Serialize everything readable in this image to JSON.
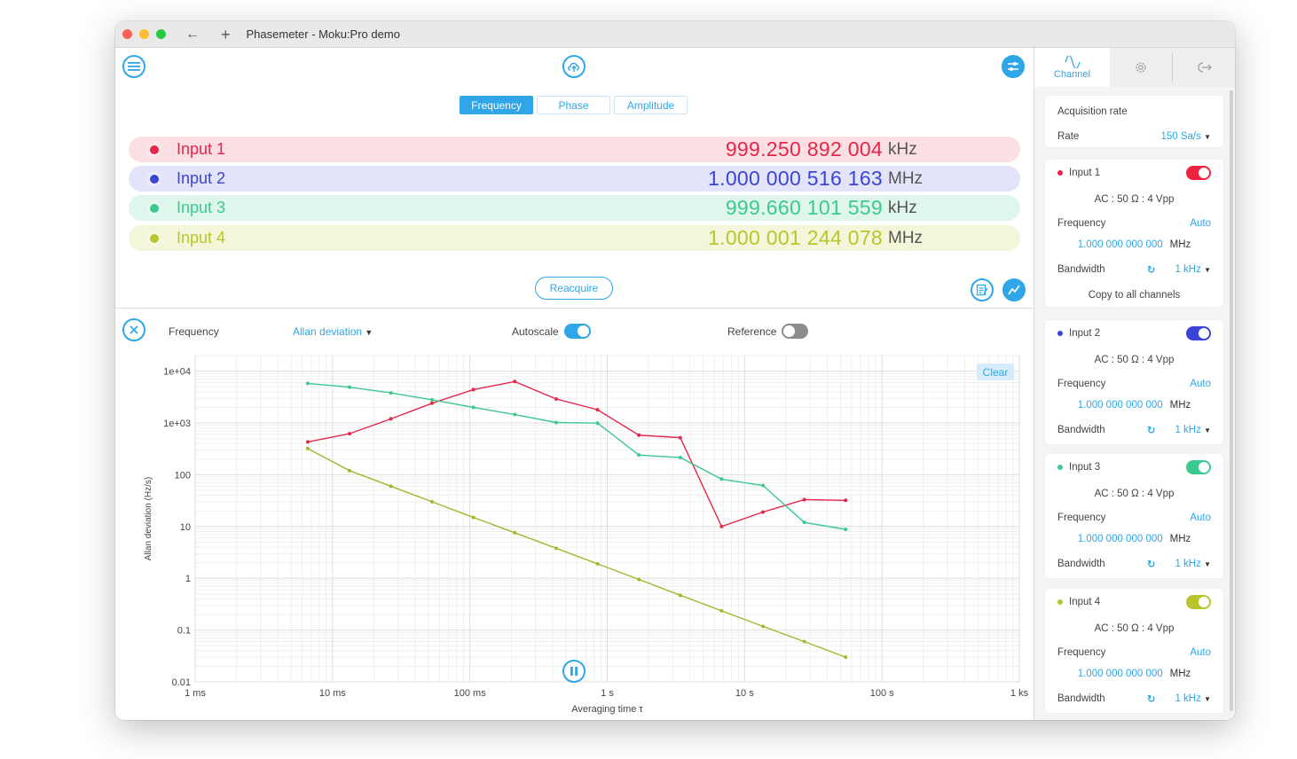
{
  "window": {
    "title": "Phasemeter - Moku:Pro demo"
  },
  "tabs": [
    {
      "label": "Frequency",
      "active": true
    },
    {
      "label": "Phase",
      "active": false
    },
    {
      "label": "Amplitude",
      "active": false
    }
  ],
  "readouts": [
    {
      "label": "Input 1",
      "value": "999.250 892 004",
      "unit": "kHz",
      "color": "#e5264a",
      "bg": "#fbdfe3"
    },
    {
      "label": "Input 2",
      "value": "1.000 000 516 163",
      "unit": "MHz",
      "color": "#3a44d6",
      "bg": "#e3e4fa"
    },
    {
      "label": "Input 3",
      "value": "999.660 101 559",
      "unit": "kHz",
      "color": "#3cc98f",
      "bg": "#dff6ec"
    },
    {
      "label": "Input 4",
      "value": "1.000 001 244 078",
      "unit": "MHz",
      "color": "#b9c52c",
      "bg": "#f4f6da"
    }
  ],
  "reacquire_label": "Reacquire",
  "plot_controls": {
    "measure": "Frequency",
    "statistic": "Allan deviation",
    "autoscale_label": "Autoscale",
    "autoscale_on": true,
    "reference_label": "Reference",
    "reference_on": false,
    "clear_label": "Clear"
  },
  "chart_data": {
    "type": "line",
    "xscale": "log",
    "yscale": "log",
    "xlabel": "Averaging time τ",
    "ylabel": "Allan deviation (Hz/s)",
    "xlim": [
      0.001,
      1000
    ],
    "ylim": [
      0.01,
      20000
    ],
    "x_ticks": [
      "1 ms",
      "10 ms",
      "100 ms",
      "1 s",
      "10 s",
      "100 s",
      "1 ks"
    ],
    "y_ticks": [
      "1e+04",
      "1e+03",
      "100",
      "10",
      "1",
      "0.1",
      "0.01"
    ],
    "grid": true,
    "x": [
      0.0066,
      0.0133,
      0.0266,
      0.053,
      0.106,
      0.212,
      0.425,
      0.85,
      1.7,
      3.4,
      6.8,
      13.6,
      27.2,
      54.4
    ],
    "series": [
      {
        "name": "Input 1",
        "color": "#e5264a",
        "values": [
          430,
          620,
          1200,
          2400,
          4400,
          6300,
          2900,
          1800,
          580,
          520,
          10,
          19,
          33,
          32
        ]
      },
      {
        "name": "Input 3",
        "color": "#3cc98f",
        "values": [
          5800,
          4900,
          3800,
          2800,
          2000,
          1450,
          1020,
          990,
          240,
          215,
          82,
          62,
          12,
          8.8
        ]
      },
      {
        "name": "Input 4",
        "color": "#a6b42e",
        "values": [
          320,
          120,
          60,
          30,
          15,
          7.6,
          3.8,
          1.9,
          0.95,
          0.47,
          0.235,
          0.118,
          0.06,
          0.03
        ]
      }
    ]
  },
  "side": {
    "tabs": [
      {
        "label": "Channel",
        "icon": "sine-wave-icon",
        "active": true
      },
      {
        "label": "",
        "icon": "gear-icon",
        "active": false
      },
      {
        "label": "",
        "icon": "export-icon",
        "active": false
      }
    ],
    "acq": {
      "title": "Acquisition rate",
      "rate_label": "Rate",
      "rate_value": "150 Sa/s"
    },
    "channels": [
      {
        "name": "Input 1",
        "color": "#e5264a",
        "toggle": "#f0233f",
        "coupling": "AC : 50 Ω : 4 Vpp",
        "freq_label": "Frequency",
        "freq_mode": "Auto",
        "freq_value": "1.000 000 000 000",
        "freq_unit": "MHz",
        "bw_label": "Bandwidth",
        "bw_value": "1 kHz",
        "copy": "Copy to all channels"
      },
      {
        "name": "Input 2",
        "color": "#3a44d6",
        "toggle": "#3a44d6",
        "coupling": "AC : 50 Ω : 4 Vpp",
        "freq_label": "Frequency",
        "freq_mode": "Auto",
        "freq_value": "1.000 000 000 000",
        "freq_unit": "MHz",
        "bw_label": "Bandwidth",
        "bw_value": "1 kHz"
      },
      {
        "name": "Input 3",
        "color": "#3cc98f",
        "toggle": "#3cc98f",
        "coupling": "AC : 50 Ω : 4 Vpp",
        "freq_label": "Frequency",
        "freq_mode": "Auto",
        "freq_value": "1.000 000 000 000",
        "freq_unit": "MHz",
        "bw_label": "Bandwidth",
        "bw_value": "1 kHz"
      },
      {
        "name": "Input 4",
        "color": "#b9c52c",
        "toggle": "#b9c52c",
        "coupling": "AC : 50 Ω : 4 Vpp",
        "freq_label": "Frequency",
        "freq_mode": "Auto",
        "freq_value": "1.000 000 000 000",
        "freq_unit": "MHz",
        "bw_label": "Bandwidth",
        "bw_value": "1 kHz"
      }
    ]
  }
}
